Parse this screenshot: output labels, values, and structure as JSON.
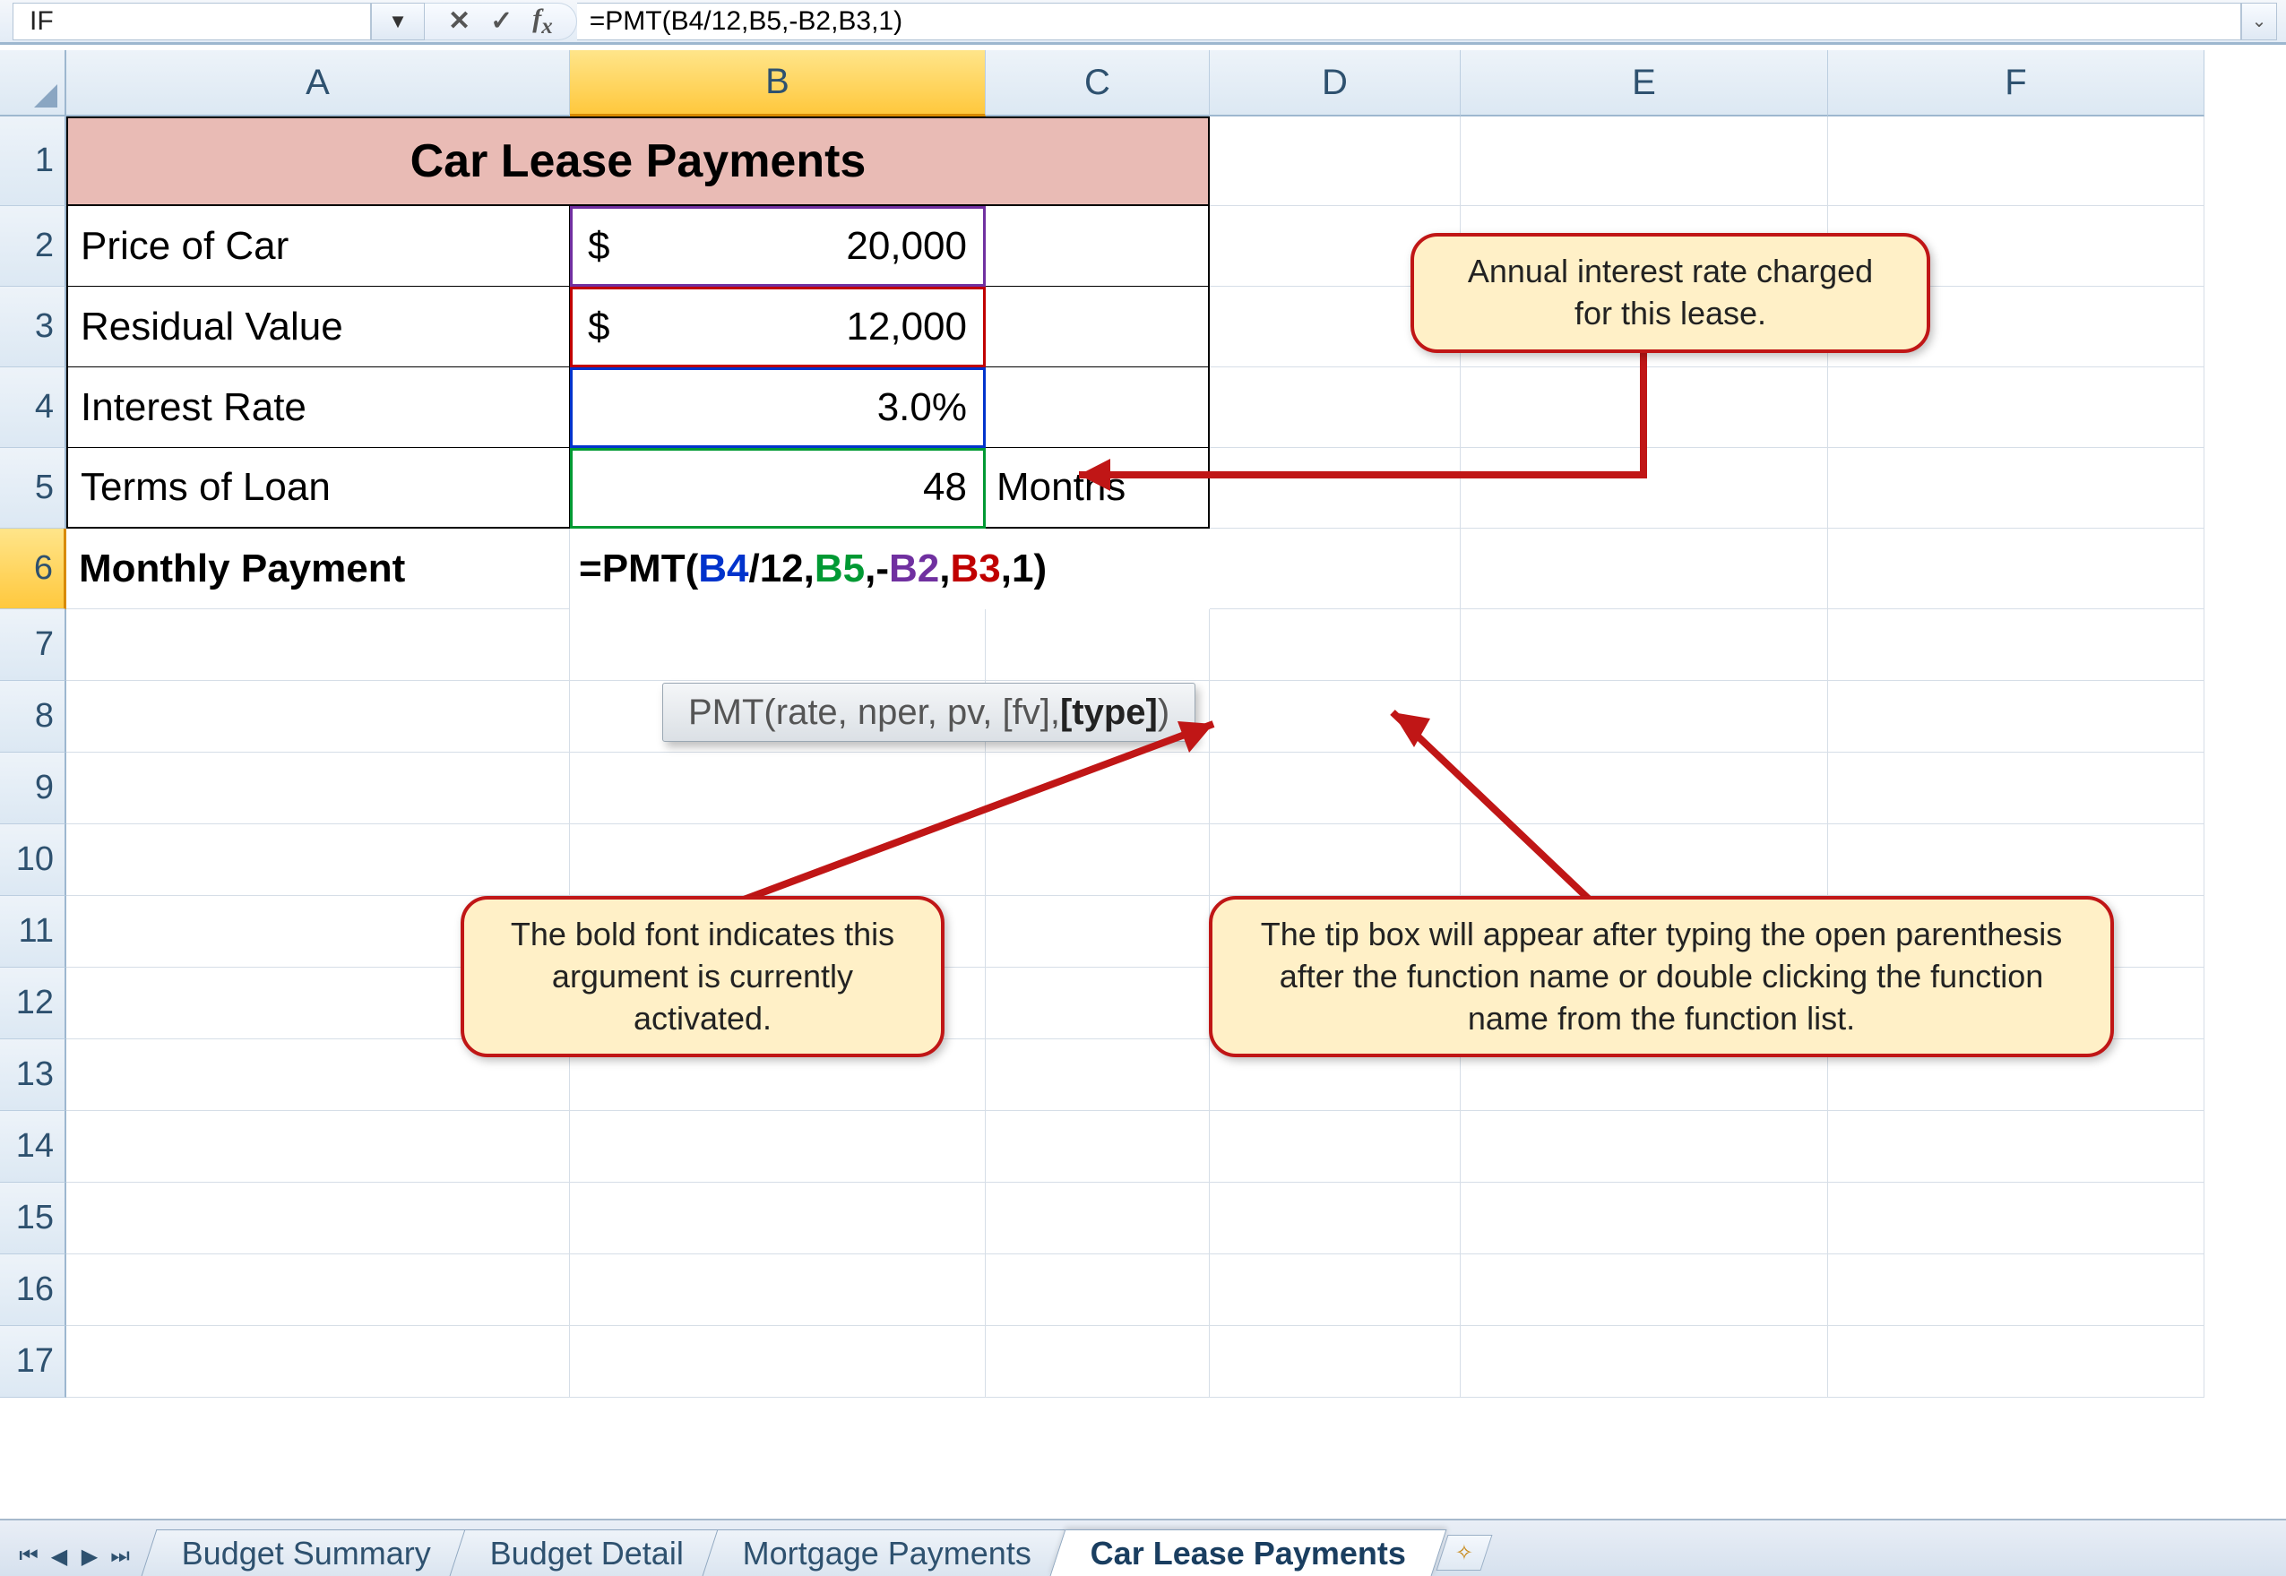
{
  "formula_bar": {
    "name_box": "IF",
    "formula": "=PMT(B4/12,B5,-B2,B3,1)"
  },
  "columns": [
    "A",
    "B",
    "C",
    "D",
    "E",
    "F"
  ],
  "rows": [
    "1",
    "2",
    "3",
    "4",
    "5",
    "6",
    "7",
    "8",
    "9",
    "10",
    "11",
    "12",
    "13",
    "14",
    "15",
    "16",
    "17"
  ],
  "sheet": {
    "title": "Car Lease Payments",
    "row2_label": "Price of Car",
    "row2_currency": "$",
    "row2_value": "20,000",
    "row3_label": "Residual Value",
    "row3_currency": "$",
    "row3_value": "12,000",
    "row4_label": "Interest Rate",
    "row4_value": "3.0%",
    "row5_label": "Terms of Loan",
    "row5_value": "48",
    "row5_unit": "Months",
    "row6_label": "Monthly Payment",
    "row6_formula_prefix": "=PMT(",
    "row6_b4": "B4",
    "row6_div": "/12,",
    "row6_b5": "B5",
    "row6_c1": ",-",
    "row6_b2": "B2",
    "row6_c2": ",",
    "row6_b3": "B3",
    "row6_suffix": ",1)"
  },
  "tooltip": {
    "prefix": "PMT(rate, nper, pv, [fv], ",
    "bold": "[type]",
    "suffix": ")"
  },
  "callouts": {
    "top": "Annual interest rate charged for this lease.",
    "left": "The bold font indicates this argument is currently activated.",
    "right": "The tip box will appear after typing the open parenthesis after the function name or double clicking the function name from the function list."
  },
  "tabs": {
    "t1": "Budget Summary",
    "t2": "Budget Detail",
    "t3": "Mortgage Payments",
    "t4": "Car Lease Payments"
  }
}
